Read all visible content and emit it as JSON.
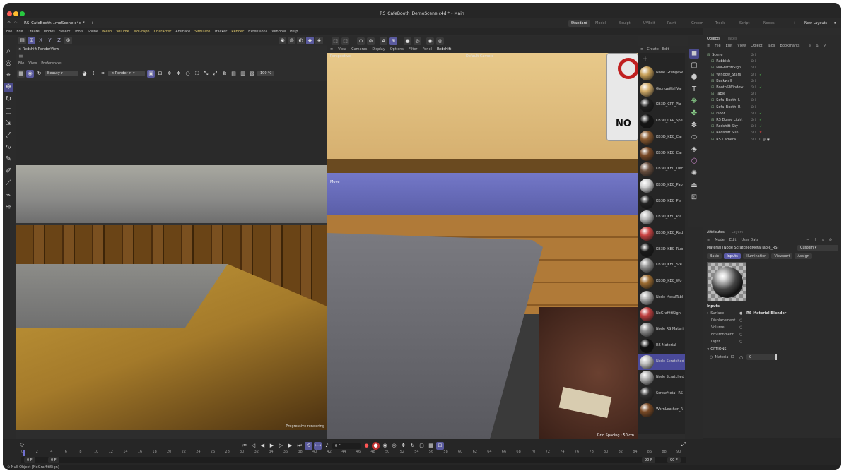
{
  "window": {
    "title": "RS_CafeBooth_DemoScene.c4d * - Main"
  },
  "tabs": {
    "doc_tab": "RS_CafeBooth...moScene.c4d *",
    "plus": "+"
  },
  "layouts": {
    "items": [
      "Standard",
      "Model",
      "Sculpt",
      "UVEdit",
      "Paint",
      "Groom",
      "Track",
      "Script",
      "Nodes"
    ],
    "new_layouts": "New Layouts"
  },
  "menus": [
    "File",
    "Edit",
    "Create",
    "Modes",
    "Select",
    "Tools",
    "Spline",
    "Mesh",
    "Volume",
    "MoGraph",
    "Character",
    "Animate",
    "Simulate",
    "Tracker",
    "Render",
    "Extensions",
    "Window",
    "Help"
  ],
  "axis": {
    "x": "X",
    "y": "Y",
    "z": "Z"
  },
  "renderview": {
    "title": "Redshift RenderView",
    "menus": [
      "File",
      "View",
      "Preferences"
    ],
    "aov": "Beauty",
    "camera": "< Render >",
    "zoom": "100 %",
    "status": "Progressive rendering"
  },
  "viewport": {
    "menus": [
      "View",
      "Cameras",
      "Display",
      "Options",
      "Filter",
      "Panel",
      "Redshift"
    ],
    "label_left": "Perspective",
    "label_right": "Default Camera",
    "move_label": "Move",
    "grid": "Grid Spacing : 50 cm",
    "sign_text": "NO"
  },
  "materials": {
    "menus": [
      "Create",
      "Edit"
    ],
    "items": [
      {
        "name": "Node GrungeW",
        "color": "#c8a058"
      },
      {
        "name": "GrungeWallVar",
        "color": "#d2ac6a"
      },
      {
        "name": "KB3D_CPP_Pla",
        "color": "#202020"
      },
      {
        "name": "KB3D_CPP_Spe",
        "color": "#151515"
      },
      {
        "name": "KB3D_KEC_Car",
        "color": "#8a5a30"
      },
      {
        "name": "KB3D_KEC_Car",
        "color": "#7a4a28"
      },
      {
        "name": "KB3D_KEC_Dec",
        "color": "#6a5040"
      },
      {
        "name": "KB3D_KEC_Pap",
        "color": "#d0d0d0"
      },
      {
        "name": "KB3D_KEC_Pla",
        "color": "#222222"
      },
      {
        "name": "KB3D_KEC_Pla",
        "color": "#bbbbbb"
      },
      {
        "name": "KB3D_KEC_Red",
        "color": "#cc4444"
      },
      {
        "name": "KB3D_KEC_Rub",
        "color": "#1a1a1a"
      },
      {
        "name": "KB3D_KEC_Ste",
        "color": "#909090"
      },
      {
        "name": "KB3D_KEC_Wo",
        "color": "#9a6a30"
      },
      {
        "name": "Node MetalTabl",
        "color": "#aaaaaa"
      },
      {
        "name": "NoGraffitiSign",
        "color": "#c04040"
      },
      {
        "name": "Node RS Materi",
        "color": "#888888"
      },
      {
        "name": "RS Material",
        "color": "#101010"
      },
      {
        "name": "Node Scratched",
        "color": "#c0c0c0"
      },
      {
        "name": "Node Scratched",
        "color": "#b0b0b0"
      },
      {
        "name": "ScrewMetal_RS",
        "color": "#303030"
      },
      {
        "name": "WornLeather_R",
        "color": "#7a4a25"
      }
    ],
    "selected_index": 18
  },
  "objects": {
    "tabs": [
      "Objects",
      "Takes"
    ],
    "menus": [
      "File",
      "Edit",
      "View",
      "Object",
      "Tags",
      "Bookmarks"
    ],
    "rows": [
      "Scene",
      "Rubbish",
      "NoGraffitiSign",
      "Window_Stars",
      "Backwall",
      "Booth&Window",
      "Table",
      "Sofa_Booth_L",
      "Sofa_Booth_R",
      "Floor",
      "RS Dome Light",
      "Redshift Sky",
      "Redshift Sun",
      "RS Camera"
    ]
  },
  "attributes": {
    "tabs": [
      "Attributes",
      "Layers"
    ],
    "menus": [
      "Mode",
      "Edit",
      "User Data"
    ],
    "material_label": "Material [Node ScratchedMetalTable_RS]",
    "preset": "Custom",
    "subtabs": [
      "Basic",
      "Inputs",
      "Illumination",
      "Viewport",
      "Assign"
    ],
    "active_subtab": "Inputs",
    "section": "Inputs",
    "surface_label": "Surface",
    "surface_value": "RS Material Blender",
    "fields": [
      "Displacement",
      "Volume",
      "Environment",
      "Light"
    ],
    "options_label": "OPTIONS",
    "material_id_label": "Material ID",
    "material_id_value": "0"
  },
  "timeline": {
    "frame": "0 F",
    "start": "0 F",
    "start2": "0 F",
    "end": "90 F",
    "end2": "90 F",
    "ticks": [
      "0",
      "2",
      "4",
      "6",
      "8",
      "10",
      "12",
      "14",
      "16",
      "18",
      "20",
      "22",
      "24",
      "26",
      "28",
      "30",
      "32",
      "34",
      "36",
      "38",
      "40",
      "42",
      "44",
      "46",
      "48",
      "50",
      "52",
      "54",
      "56",
      "58",
      "60",
      "62",
      "64",
      "66",
      "68",
      "70",
      "72",
      "74",
      "76",
      "78",
      "80",
      "82",
      "84",
      "86",
      "88",
      "90"
    ]
  },
  "status": {
    "text": "Null Object [NoGraffitiSign]"
  }
}
